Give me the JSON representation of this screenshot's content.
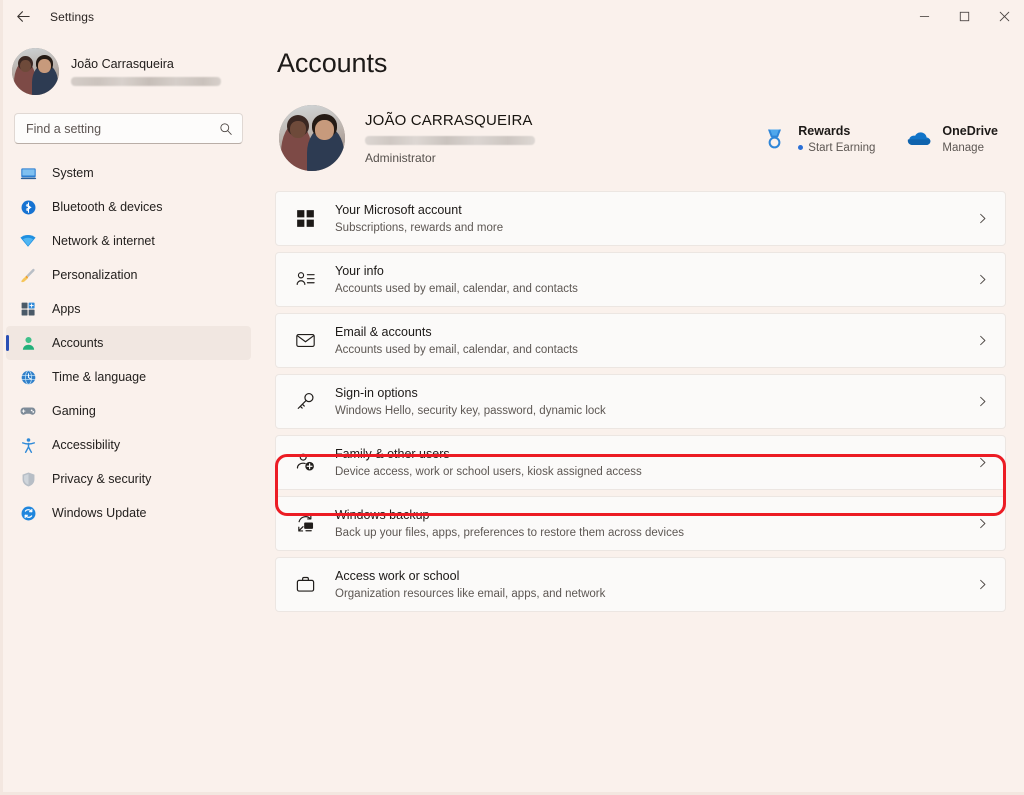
{
  "window": {
    "title": "Settings",
    "back_label": "Back",
    "controls": {
      "minimize": "Minimize",
      "maximize": "Maximize",
      "close": "Close"
    }
  },
  "sidebar": {
    "profile": {
      "name": "João Carrasqueira",
      "email_redacted": true
    },
    "search": {
      "placeholder": "Find a setting",
      "value": "",
      "icon": "search-icon"
    },
    "items": [
      {
        "label": "System",
        "icon": "system-icon",
        "selected": false
      },
      {
        "label": "Bluetooth & devices",
        "icon": "bluetooth-icon",
        "selected": false
      },
      {
        "label": "Network & internet",
        "icon": "network-icon",
        "selected": false
      },
      {
        "label": "Personalization",
        "icon": "paintbrush-icon",
        "selected": false
      },
      {
        "label": "Apps",
        "icon": "apps-icon",
        "selected": false
      },
      {
        "label": "Accounts",
        "icon": "accounts-icon",
        "selected": true
      },
      {
        "label": "Time & language",
        "icon": "time-language-icon",
        "selected": false
      },
      {
        "label": "Gaming",
        "icon": "gaming-icon",
        "selected": false
      },
      {
        "label": "Accessibility",
        "icon": "accessibility-icon",
        "selected": false
      },
      {
        "label": "Privacy & security",
        "icon": "shield-icon",
        "selected": false
      },
      {
        "label": "Windows Update",
        "icon": "update-icon",
        "selected": false
      }
    ]
  },
  "main": {
    "page_title": "Accounts",
    "account": {
      "name": "JOÃO CARRASQUEIRA",
      "email_redacted": true,
      "role": "Administrator"
    },
    "account_links": [
      {
        "title": "Rewards",
        "subtitle": "Start Earning",
        "icon": "rewards-medal-icon",
        "has_dot": true
      },
      {
        "title": "OneDrive",
        "subtitle": "Manage",
        "icon": "onedrive-cloud-icon",
        "has_dot": false
      }
    ],
    "cards": [
      {
        "title": "Your Microsoft account",
        "subtitle": "Subscriptions, rewards and more",
        "icon": "microsoft-logo-icon",
        "chevron": "chevron-right-icon",
        "highlighted": false
      },
      {
        "title": "Your info",
        "subtitle": "Accounts used by email, calendar, and contacts",
        "icon": "person-info-icon",
        "chevron": "chevron-right-icon",
        "highlighted": false
      },
      {
        "title": "Email & accounts",
        "subtitle": "Accounts used by email, calendar, and contacts",
        "icon": "mail-envelope-icon",
        "chevron": "chevron-right-icon",
        "highlighted": false
      },
      {
        "title": "Sign-in options",
        "subtitle": "Windows Hello, security key, password, dynamic lock",
        "icon": "key-icon",
        "chevron": "chevron-right-icon",
        "highlighted": false
      },
      {
        "title": "Family & other users",
        "subtitle": "Device access, work or school users, kiosk assigned access",
        "icon": "person-add-icon",
        "chevron": "chevron-right-icon",
        "highlighted": true
      },
      {
        "title": "Windows backup",
        "subtitle": "Back up your files, apps, preferences to restore them across devices",
        "icon": "backup-sync-icon",
        "chevron": "chevron-right-icon",
        "highlighted": false
      },
      {
        "title": "Access work or school",
        "subtitle": "Organization resources like email, apps, and network",
        "icon": "briefcase-icon",
        "chevron": "chevron-right-icon",
        "highlighted": false
      }
    ]
  },
  "annotation": {
    "type": "red-rounded-rectangle",
    "color": "#ec1c24",
    "targets": "Family & other users"
  },
  "colors": {
    "page_background": "#faf1ec",
    "card_background": "#fbfaf9",
    "card_border": "#ece6e2",
    "selected_nav": "#f1e7e1",
    "accent_indicator": "#2a4fb5",
    "annotation_red": "#ec1c24",
    "text_primary": "#1c1917",
    "text_secondary": "#5d5753"
  }
}
